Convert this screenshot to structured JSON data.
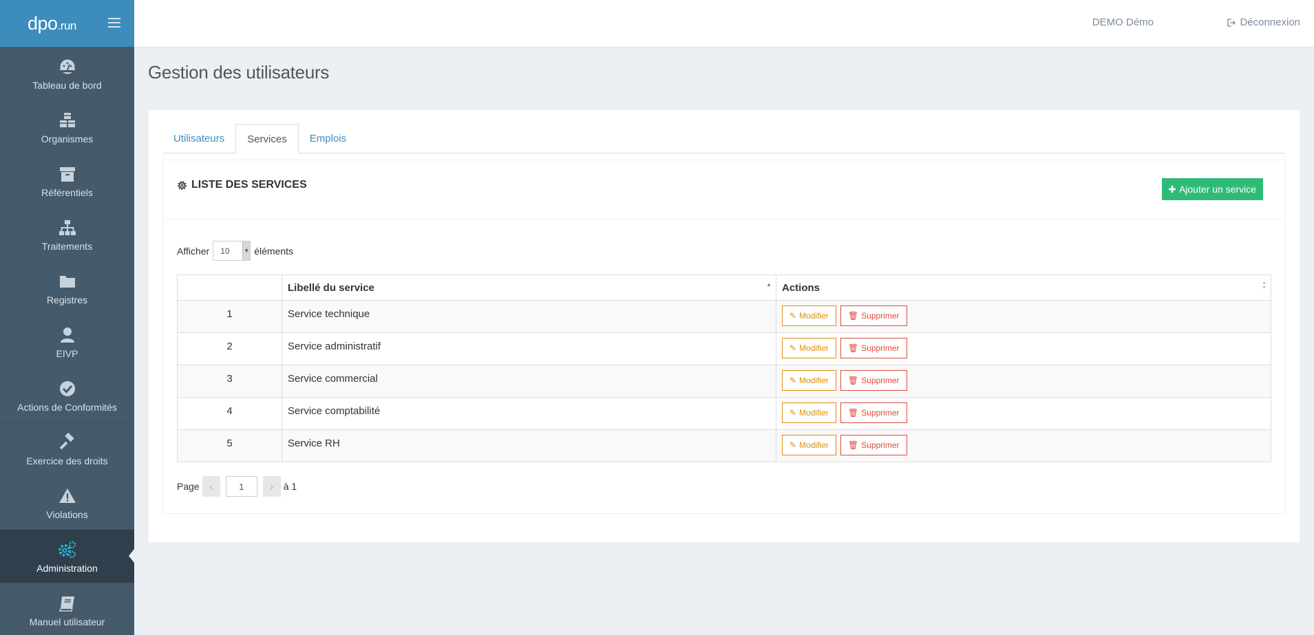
{
  "app": {
    "logo_main": "dpo",
    "logo_suffix": ".run"
  },
  "header": {
    "user": "DEMO Démo",
    "logout": "Déconnexion"
  },
  "sidebar": {
    "items": [
      {
        "label": "Tableau de bord",
        "icon": "dashboard-icon"
      },
      {
        "label": "Organismes",
        "icon": "cubes-icon"
      },
      {
        "label": "Référentiels",
        "icon": "archive-icon"
      },
      {
        "label": "Traitements",
        "icon": "sitemap-icon"
      },
      {
        "label": "Registres",
        "icon": "folder-icon"
      },
      {
        "label": "EIVP",
        "icon": "user-icon"
      },
      {
        "label": "Actions de Conformités",
        "icon": "check-circle-icon"
      },
      {
        "label": "Exercice des droits",
        "icon": "gavel-icon"
      },
      {
        "label": "Violations",
        "icon": "warning-icon"
      },
      {
        "label": "Administration",
        "icon": "cogs-icon",
        "active": true
      },
      {
        "label": "Manuel utilisateur",
        "icon": "book-icon"
      }
    ]
  },
  "page": {
    "title": "Gestion des utilisateurs"
  },
  "tabs": [
    {
      "label": "Utilisateurs"
    },
    {
      "label": "Services",
      "active": true
    },
    {
      "label": "Emplois"
    }
  ],
  "box": {
    "title": "LISTE DES SERVICES",
    "add_button": "Ajouter un service"
  },
  "length": {
    "before": "Afficher",
    "value": "10",
    "after": "éléments"
  },
  "table": {
    "headers": [
      "",
      "Libellé du service",
      "Actions"
    ],
    "edit_label": "Modifier",
    "delete_label": "Supprimer",
    "rows": [
      {
        "num": "1",
        "name": "Service technique"
      },
      {
        "num": "2",
        "name": "Service administratif"
      },
      {
        "num": "3",
        "name": "Service commercial"
      },
      {
        "num": "4",
        "name": "Service comptabilité"
      },
      {
        "num": "5",
        "name": "Service RH"
      }
    ]
  },
  "pagination": {
    "label": "Page",
    "prev": "‹",
    "current": "1",
    "next": "›",
    "total": "à 1"
  },
  "colors": {
    "primary": "#3c8dbc",
    "sidebar": "#455a6a",
    "success": "#2fbb77",
    "warning": "#e08e0b",
    "danger": "#dd4b39"
  }
}
